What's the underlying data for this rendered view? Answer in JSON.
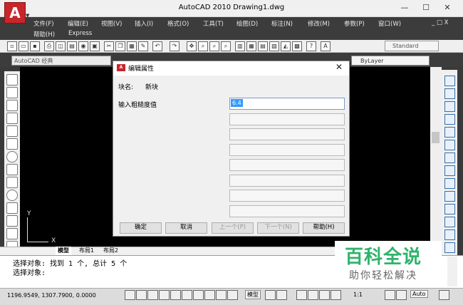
{
  "window": {
    "title": "AutoCAD 2010     Drawing1.dwg",
    "minimize": "—",
    "maximize": "☐",
    "close": "✕"
  },
  "app_logo": "A",
  "menu": {
    "row1": [
      "文件(F)",
      "编辑(E)",
      "视图(V)",
      "插入(I)",
      "格式(O)",
      "工具(T)",
      "绘图(D)",
      "标注(N)",
      "修改(M)",
      "参数(P)",
      "窗口(W)"
    ],
    "row2": [
      "帮助(H)",
      "Express"
    ],
    "window_controls": "_ □ X"
  },
  "toolbar": {
    "text_style": "Standard"
  },
  "workspace": {
    "selected": "AutoCAD 经典"
  },
  "layer": {
    "selected": "ByLayer"
  },
  "ucs": {
    "x": "X",
    "y": "Y"
  },
  "layout_tabs": [
    "模型",
    "布局1",
    "布局2"
  ],
  "command": {
    "lines": [
      "选择对象: 找到 1 个, 总计 5 个",
      "选择对象:"
    ]
  },
  "status": {
    "coords": "1196.9549, 1307.7900, 0.0000",
    "model_label": "模型",
    "scale": "1:1",
    "auto": "Auto"
  },
  "dialog": {
    "title": "编辑属性",
    "block_name_label": "块名:",
    "block_name_value": "新块",
    "prompt_label": "输入粗糙度值",
    "first_value": "6.4",
    "buttons": {
      "ok": "确定",
      "cancel": "取消",
      "prev": "上一个(P)",
      "next": "下一个(N)",
      "help": "帮助(H)"
    }
  },
  "watermark": {
    "title": "百科全说",
    "subtitle": "助你轻松解决"
  },
  "colors": {
    "logo_red": "#c8262a",
    "canvas": "#000000",
    "watermark_green": "#2fb36b",
    "selection_blue": "#3399ff"
  }
}
